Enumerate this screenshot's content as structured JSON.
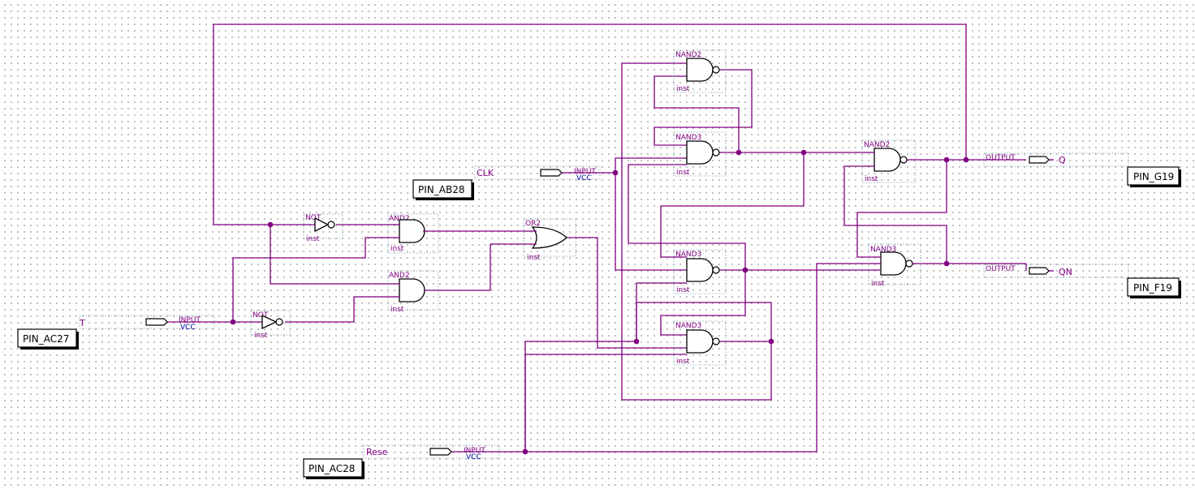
{
  "gate_labels": {
    "not": "NOT",
    "and": "AND2",
    "or": "OR2",
    "nand2": "NAND2",
    "nand3": "NAND3",
    "inst": "inst"
  },
  "io_labels": {
    "input": "INPUT",
    "vcc": "VCC",
    "output": "OUTPUT"
  },
  "signals": {
    "t": "T",
    "clk": "CLK",
    "reset": "Rese",
    "q": "Q",
    "qn": "QN"
  },
  "pins": {
    "t": "PIN_AC27",
    "clk": "PIN_AB28",
    "reset": "PIN_AC28",
    "q": "PIN_G19",
    "qn": "PIN_F19"
  },
  "colors": {
    "wire": "#800080",
    "gate_outline": "#000000",
    "vcc_label": "#0000a0",
    "grid_dot": "#9a9a9a"
  }
}
